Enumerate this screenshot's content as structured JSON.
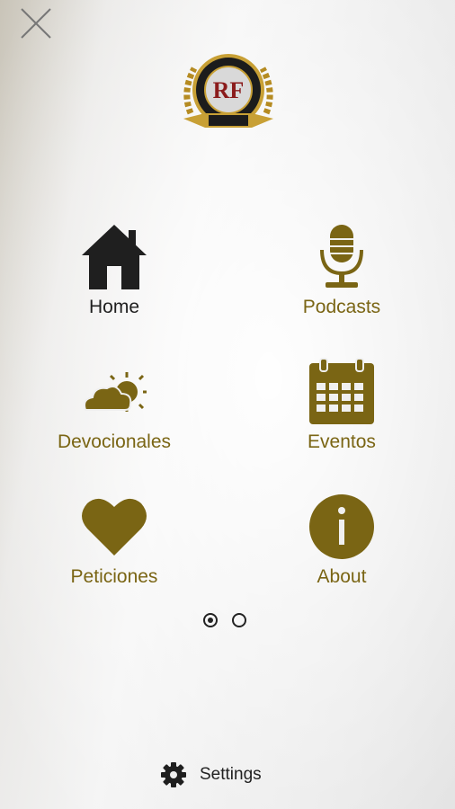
{
  "menu": {
    "tiles": [
      {
        "label": "Home",
        "icon": "home-icon"
      },
      {
        "label": "Podcasts",
        "icon": "microphone-icon"
      },
      {
        "label": "Devocionales",
        "icon": "partly-cloudy-icon"
      },
      {
        "label": "Eventos",
        "icon": "calendar-icon"
      },
      {
        "label": "Peticiones",
        "icon": "heart-icon"
      },
      {
        "label": "About",
        "icon": "info-icon"
      }
    ]
  },
  "logo": {
    "monogram": "RF"
  },
  "pager": {
    "pages": 2,
    "current": 1
  },
  "footer": {
    "settings_label": "Settings"
  },
  "colors": {
    "accent": "#7a6514",
    "active": "#1f1f1f",
    "logo_red": "#8b1c1c"
  }
}
